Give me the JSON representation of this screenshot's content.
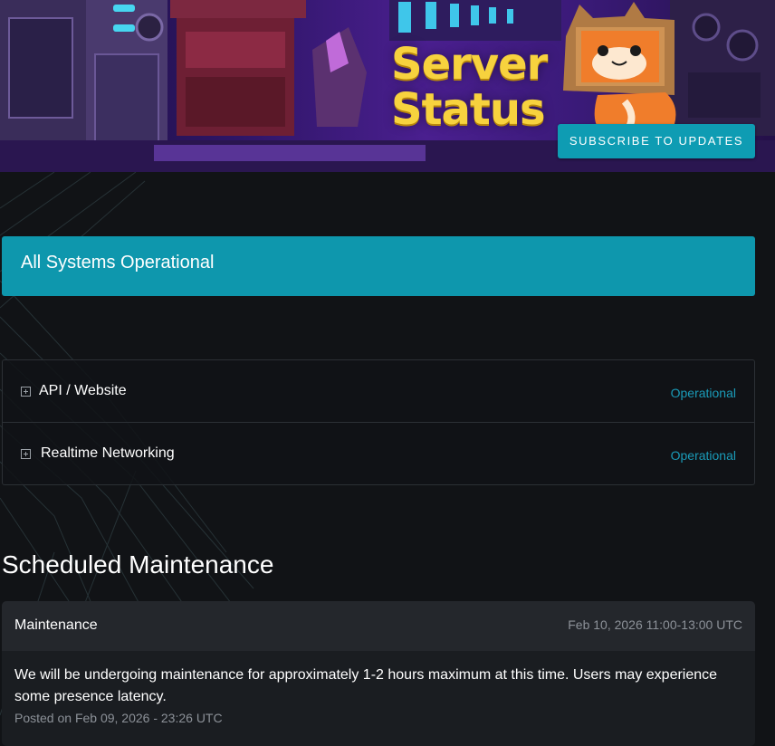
{
  "header": {
    "logo_line1": "Server",
    "logo_line2": "Status",
    "subscribe_label": "SUBSCRIBE TO UPDATES",
    "accent_color": "#0e9cb3",
    "logo_color": "#f7d23e"
  },
  "status": {
    "overall": "All Systems Operational",
    "color": "#0e97ad"
  },
  "components": [
    {
      "name": "API / Website",
      "status": "Operational",
      "icon": "expand-plus-icon"
    },
    {
      "name": "Realtime Networking",
      "status": "Operational",
      "icon": "expand-plus-icon"
    }
  ],
  "scheduled": {
    "title": "Scheduled Maintenance",
    "items": [
      {
        "name": "Maintenance",
        "window": "Feb 10, 2026 11:00-13:00 UTC",
        "body": "We will be undergoing maintenance for approximately 1-2 hours maximum at this time. Users may experience some presence latency.",
        "posted": "Posted on Feb 09, 2026 - 23:26 UTC"
      }
    ]
  }
}
